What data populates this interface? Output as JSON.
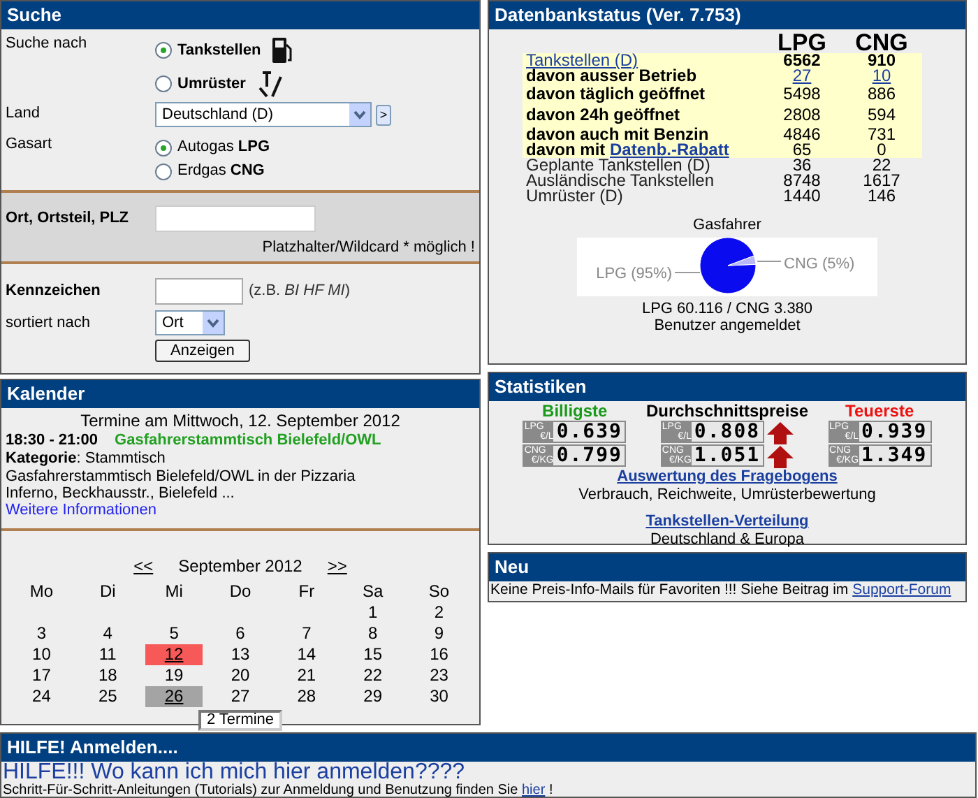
{
  "search": {
    "title": "Suche",
    "search_for": {
      "label": "Suche nach",
      "options": [
        {
          "label": "Tankstellen",
          "selected": true,
          "kind": "pump"
        },
        {
          "label": "Umrüster",
          "selected": false,
          "kind": "tools"
        }
      ]
    },
    "country": {
      "label": "Land",
      "value": "Deutschland (D)",
      "go": ">"
    },
    "gas": {
      "label": "Gasart",
      "options": [
        {
          "label": "Autogas **LPG**",
          "selected": true
        },
        {
          "label": "Erdgas **CNG**",
          "selected": false
        }
      ]
    },
    "place": {
      "label": "Ort, Ortsteil, PLZ",
      "hint": "Platzhalter/Wildcard * möglich !"
    },
    "plate": {
      "label": "Kennzeichen",
      "example": "(z.B. *BI HF MI*)"
    },
    "sort": {
      "label": "sortiert nach",
      "value": "Ort"
    },
    "submit": "Anzeigen"
  },
  "calendar": {
    "title": "Kalender",
    "date_heading": "Termine am Mittwoch, 12. September 2012",
    "event": {
      "time": "18:30 - 21:00",
      "title": "Gasfahrerstammtisch Bielefeld/OWL",
      "category_label": "Kategorie",
      "category": ": Stammtisch",
      "description": "Gasfahrerstammtisch Bielefeld/OWL in der Pizzaria Inferno, Beckhausstr., Bielefeld ...",
      "more": "Weitere Informationen"
    },
    "prev": "<<",
    "month": "September 2012",
    "next": ">>",
    "weekdays": [
      "Mo",
      "Di",
      "Mi",
      "Do",
      "Fr",
      "Sa",
      "So"
    ],
    "weeks": [
      [
        {
          "day": "1",
          "selected": false,
          "events": false
        },
        {
          "day": "2",
          "selected": false,
          "events": false
        }
      ],
      [
        {
          "day": "3",
          "selected": false,
          "events": false
        },
        {
          "day": "4",
          "selected": false,
          "events": false
        },
        {
          "day": "5",
          "selected": false,
          "events": false
        },
        {
          "day": "6",
          "selected": false,
          "events": false
        },
        {
          "day": "7",
          "selected": false,
          "events": false
        },
        {
          "day": "8",
          "selected": false,
          "events": false
        },
        {
          "day": "9",
          "selected": false,
          "events": false
        }
      ],
      [
        {
          "day": "10",
          "selected": false,
          "events": false
        },
        {
          "day": "11",
          "selected": false,
          "events": false
        },
        {
          "day": "12",
          "selected": true,
          "events": true
        },
        {
          "day": "13",
          "selected": false,
          "events": false
        },
        {
          "day": "14",
          "selected": false,
          "events": false
        },
        {
          "day": "15",
          "selected": false,
          "events": false
        },
        {
          "day": "16",
          "selected": false,
          "events": false
        }
      ],
      [
        {
          "day": "17",
          "selected": false,
          "events": false
        },
        {
          "day": "18",
          "selected": false,
          "events": false
        },
        {
          "day": "19",
          "selected": false,
          "events": false
        },
        {
          "day": "20",
          "selected": false,
          "events": false
        },
        {
          "day": "21",
          "selected": false,
          "events": false
        },
        {
          "day": "22",
          "selected": false,
          "events": false
        },
        {
          "day": "23",
          "selected": false,
          "events": false
        }
      ],
      [
        {
          "day": "24",
          "selected": false,
          "events": false
        },
        {
          "day": "25",
          "selected": false,
          "events": false
        },
        {
          "day": "26",
          "selected": false,
          "events": true
        },
        {
          "day": "27",
          "selected": false,
          "events": false
        },
        {
          "day": "28",
          "selected": false,
          "events": false
        },
        {
          "day": "29",
          "selected": false,
          "events": false
        },
        {
          "day": "30",
          "selected": false,
          "events": false
        }
      ]
    ],
    "button": "2 Termine"
  },
  "database": {
    "title": "Datenbankstatus (Ver. 7.753)",
    "columns": [
      "LPG",
      "CNG"
    ],
    "rows": [
      {
        "label": "Tankstellen (D)",
        "lpg": "6562",
        "cng": "910",
        "kind": "link-label",
        "highlighted": true
      },
      {
        "label": "davon ausser Betrieb",
        "lpg": "27",
        "cng": "10",
        "kind": "link-values",
        "highlighted": true
      },
      {
        "label": "davon täglich geöffnet",
        "lpg": "5498",
        "cng": "886",
        "kind": "bold",
        "highlighted": true
      },
      {
        "label": "davon 24h geöffnet",
        "lpg": "2808",
        "cng": "594",
        "kind": "bold",
        "highlighted": true
      },
      {
        "label": "davon auch mit Benzin",
        "lpg": "4846",
        "cng": "731",
        "kind": "bold",
        "highlighted": true
      },
      {
        "label": "davon mit",
        "link": "Datenb.-Rabatt",
        "lpg": "65",
        "cng": "0",
        "kind": "bold-link",
        "highlighted": true
      },
      {
        "label": "Geplante Tankstellen (D)",
        "lpg": "36",
        "cng": "22",
        "kind": "plain",
        "highlighted": false
      },
      {
        "label": "Ausländische Tankstellen",
        "lpg": "8748",
        "cng": "1617",
        "kind": "plain",
        "highlighted": false
      },
      {
        "label": "Umrüster (D)",
        "lpg": "1440",
        "cng": "146",
        "kind": "plain",
        "highlighted": false
      }
    ],
    "chart_data": {
      "type": "pie",
      "title": "Gasfahrer",
      "categories": [
        "LPG (95%)",
        "CNG (5%)"
      ],
      "values": [
        95,
        5
      ]
    },
    "users": "LPG 60.116 / CNG 3.380",
    "users_note": "Benutzer angemeldet"
  },
  "statistics": {
    "title": "Statistiken",
    "groups": [
      {
        "label": "Billigste",
        "color": "#1a9a1a",
        "prices": [
          {
            "fuel": "LPG",
            "unit": "€/L",
            "value": "0.639",
            "rising": false
          },
          {
            "fuel": "CNG",
            "unit": "€/KG",
            "value": "0.799",
            "rising": false
          }
        ]
      },
      {
        "label": "Durchschnittspreise",
        "color": "#000000",
        "prices": [
          {
            "fuel": "LPG",
            "unit": "€/L",
            "value": "0.808",
            "rising": true
          },
          {
            "fuel": "CNG",
            "unit": "€/KG",
            "value": "1.051",
            "rising": true
          }
        ]
      },
      {
        "label": "Teuerste",
        "color": "#ee1111",
        "prices": [
          {
            "fuel": "LPG",
            "unit": "€/L",
            "value": "0.939",
            "rising": false
          },
          {
            "fuel": "CNG",
            "unit": "€/KG",
            "value": "1.349",
            "rising": false
          }
        ]
      }
    ],
    "links": [
      {
        "title": "Auswertung des Fragebogens",
        "note": "Verbrauch, Reichweite, Umrüsterbewertung"
      },
      {
        "title": "Tankstellen-Verteilung",
        "note": "Deutschland & Europa"
      }
    ]
  },
  "news": {
    "title": "Neu",
    "text": "Keine Preis-Info-Mails für Favoriten !!! Siehe Beitrag im",
    "link": "Support-Forum"
  },
  "help": {
    "title": "HILFE! Anmelden....",
    "headline": "HILFE!!! Wo kann ich mich hier anmelden????",
    "text": "Schritt-Für-Schritt-Anleitungen (Tutorials) zur Anmeldung und Benutzung finden Sie",
    "link": "hier",
    "tail": "!"
  }
}
